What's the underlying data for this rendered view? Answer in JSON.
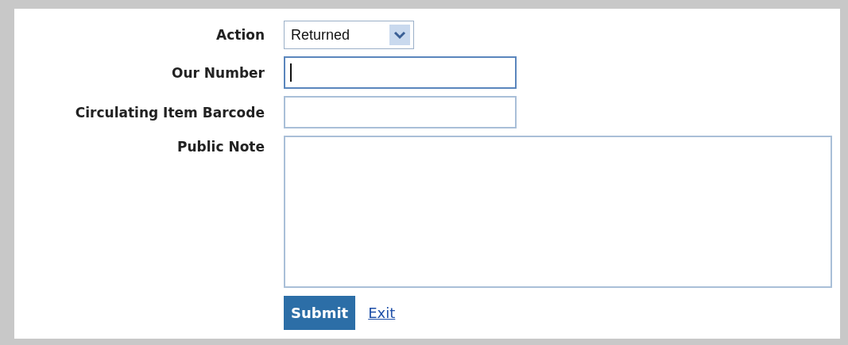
{
  "fields": [
    {
      "label": "Action",
      "kind": "select",
      "value": "Returned"
    },
    {
      "label": "Our Number",
      "kind": "text",
      "focused": true
    },
    {
      "label": "Circulating Item Barcode",
      "kind": "text",
      "focused": false
    },
    {
      "label": "Public Note",
      "kind": "textarea",
      "focused": false
    }
  ],
  "submit": "Submit",
  "exit": "Exit"
}
